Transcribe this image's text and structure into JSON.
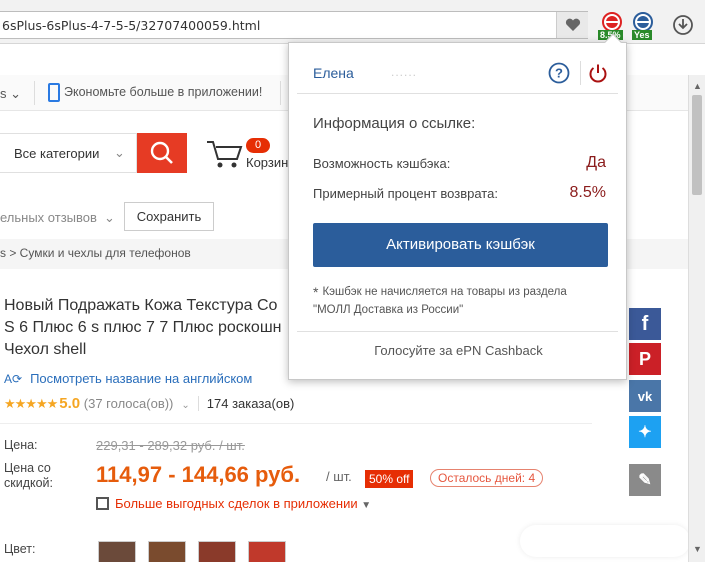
{
  "browser": {
    "url": "6sPlus-6sPlus-4-7-5-5/32707400059.html",
    "extensions": [
      {
        "name": "epn-cashback-icon",
        "badge": "8.5%"
      },
      {
        "name": "epn-status-icon",
        "badge": "Yes"
      }
    ]
  },
  "topstrip": {
    "app_promo": "Экономьте больше в приложении!"
  },
  "search": {
    "category": "Все категории",
    "cart_count": "0",
    "cart_label": "Корзина"
  },
  "reviews": {
    "label": "ельных отзывов",
    "save_label": "Сохранить"
  },
  "breadcrumb": {
    "text": "s > Сумки и чехлы для телефонов"
  },
  "product": {
    "title_lines": [
      "Новый Подражать Кожа Текстура Со",
      "S 6 Плюс 6 s плюс 7 7 Плюс роскошн",
      "Чехол shell"
    ],
    "english_link": "Посмотреть название на английском",
    "stars": "★★★★★",
    "rating": "5.0",
    "votes": "(37 голоса(ов))",
    "orders": "174 заказа(ов)",
    "price_label": "Цена:",
    "old_price": "229,31 - 289,32 руб. / шт.",
    "discount_label_1": "Цена со",
    "discount_label_2": "скидкой:",
    "new_price": "114,97 - 144,66 руб.",
    "per_unit": "/ шт.",
    "off_badge": "50% off",
    "days_left": "Осталось дней: 4",
    "deals_link": "Больше выгодных сделок в приложении",
    "color_label": "Цвет:"
  },
  "popup": {
    "user": "Елена",
    "user_masked": "......",
    "title": "Информация о ссылке:",
    "cashback_label": "Возможность кэшбэка:",
    "cashback_value": "Да",
    "percent_label": "Примерный процент возврата:",
    "percent_value": "8.5%",
    "activate_label": "Активировать кэшбэк",
    "note_line1": "Кэшбэк не начисляется на товары из раздела",
    "note_line2": "\"МОЛЛ Доставка из России\"",
    "note_asterisk": "*",
    "vote_label": "Голосуйте за ePN Cashback"
  },
  "social": [
    "facebook-icon",
    "pinterest-icon",
    "vk-icon",
    "twitter-icon"
  ],
  "colors": {
    "accent_red": "#e63b24",
    "price_orange": "#e65c0c",
    "popup_blue": "#2b5d9b",
    "popup_value": "#8b1c1c"
  }
}
